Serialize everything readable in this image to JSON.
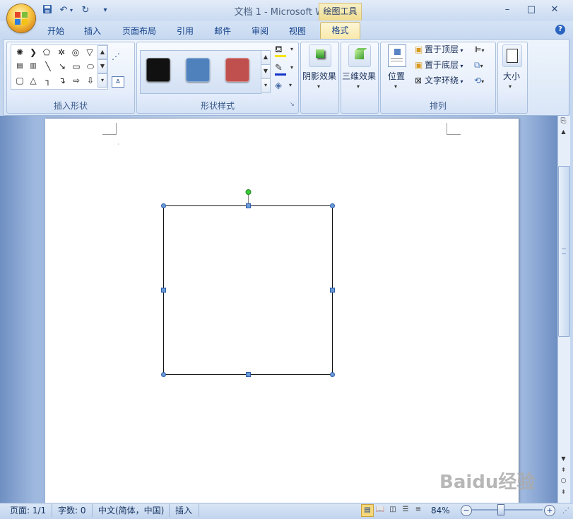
{
  "window": {
    "title": "文档 1 - Microsoft Word",
    "context_tab_group": "绘图工具",
    "minimize": "–",
    "maximize": "□",
    "close": "✕"
  },
  "quick_access": {
    "save_icon": "save-icon",
    "undo_icon": "undo-icon",
    "redo_icon": "redo-icon",
    "customize_icon": "customize-icon"
  },
  "tabs": [
    "开始",
    "插入",
    "页面布局",
    "引用",
    "邮件",
    "审阅",
    "视图"
  ],
  "active_tab": "格式",
  "ribbon": {
    "insert_shapes": {
      "label": "插入形状"
    },
    "shape_styles": {
      "label": "形状样式",
      "swatches": [
        "#111111",
        "#4f81bd",
        "#c0504d"
      ]
    },
    "shadow_effects": {
      "label": "阴影效果"
    },
    "3d_effects": {
      "label": "三维效果"
    },
    "arrange": {
      "label": "排列",
      "position": "位置",
      "bring_to_front": "置于顶层",
      "send_to_back": "置于底层",
      "text_wrapping": "文字环绕"
    },
    "size": {
      "label": "大小"
    }
  },
  "status_bar": {
    "page": "页面: 1/1",
    "words": "字数: 0",
    "language": "中文(简体，中国)",
    "mode": "插入",
    "zoom": "84%"
  },
  "watermark": "Baidu经验",
  "colors": {
    "accent": "#15428b",
    "handle_fill": "#4f81bd",
    "rotate_handle": "#3cc83c"
  }
}
